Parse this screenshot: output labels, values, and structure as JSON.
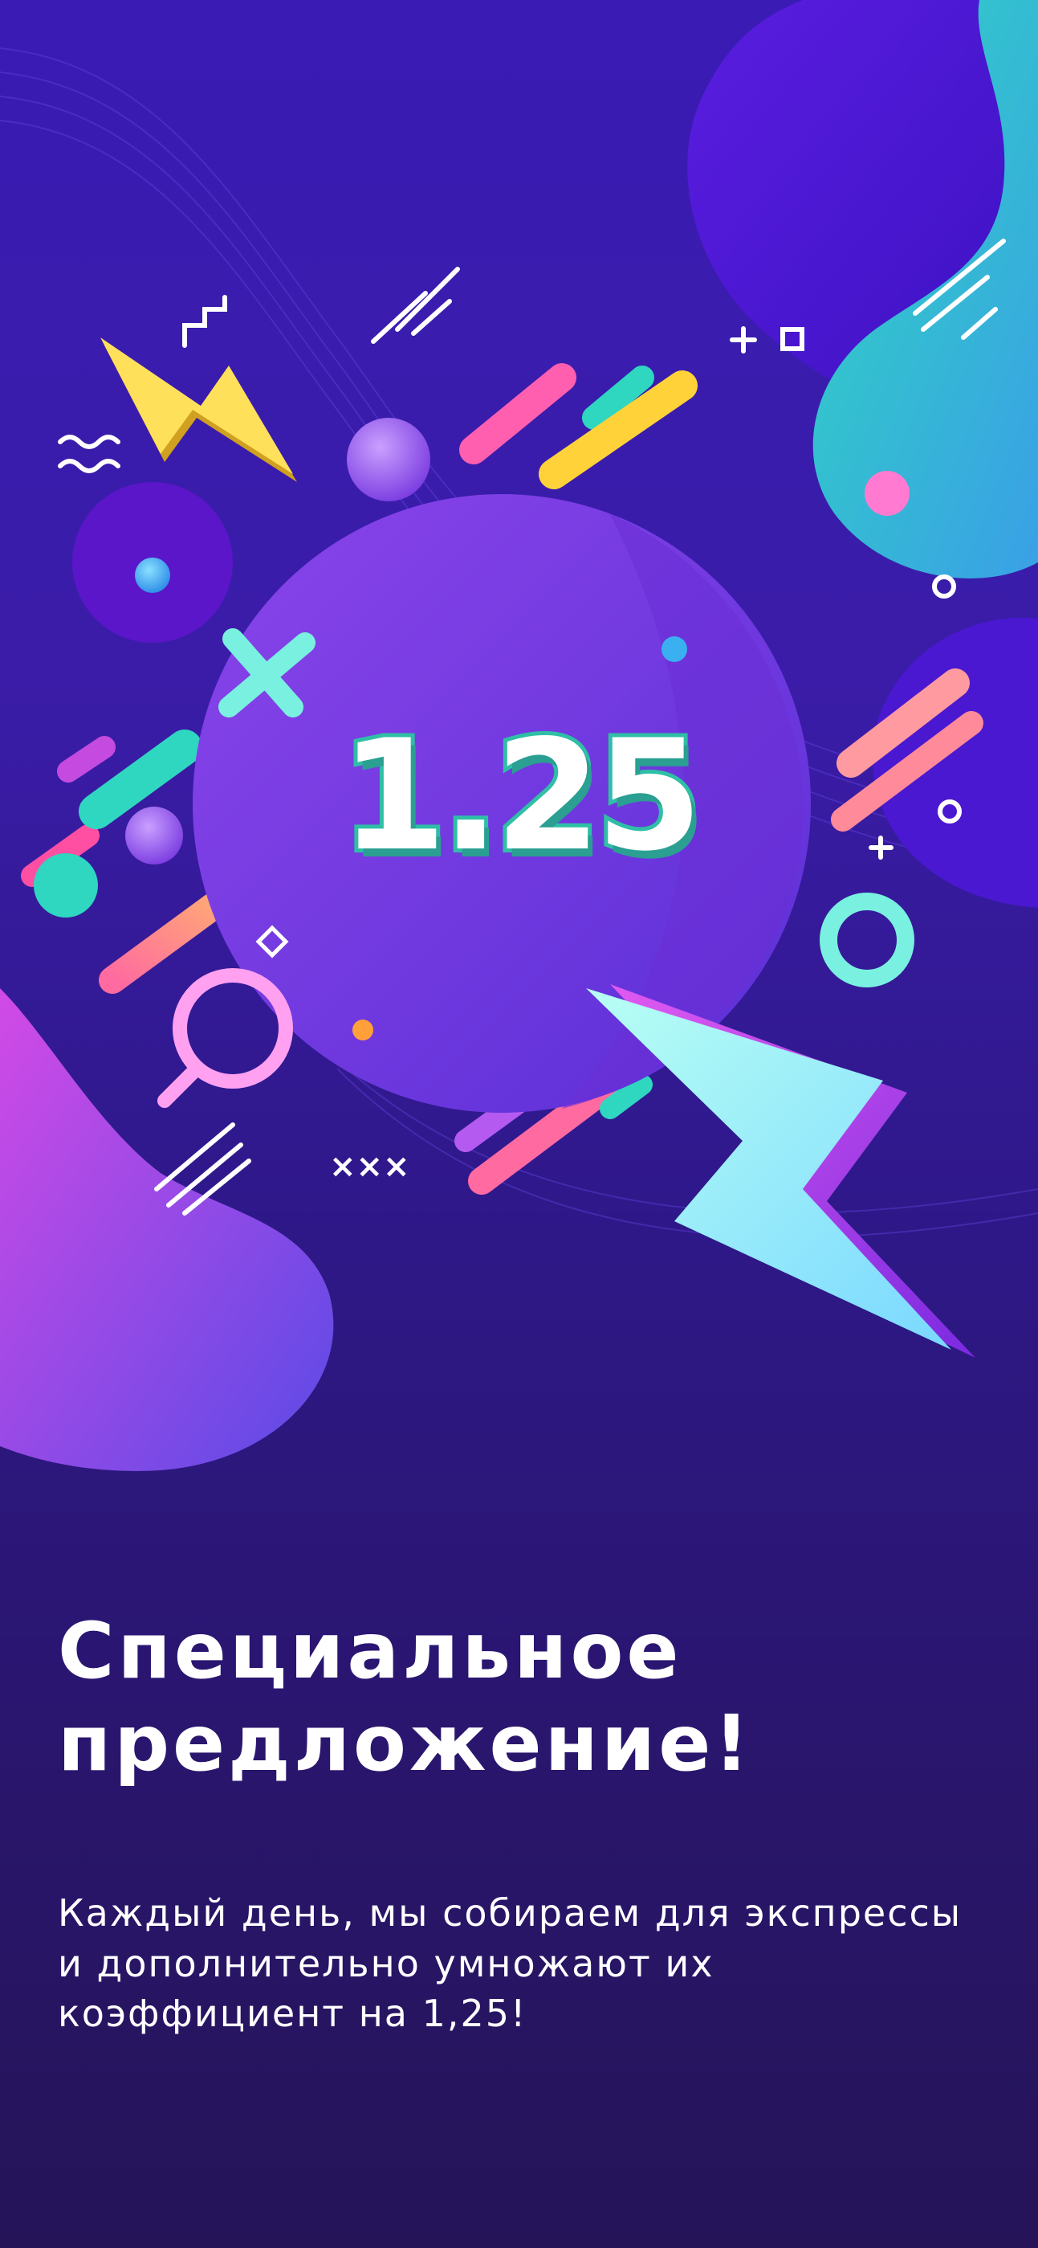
{
  "promo": {
    "multiplier": "1.25",
    "headline": "Специальное предложение!",
    "description": "Каждый день, мы собираем для экспрессы и дополнительно умножают их коэффициент на 1,25!"
  },
  "decor": {
    "cross_marks": "×××",
    "icons": [
      "lightning-bolt-icon",
      "zigzag-icon",
      "wave-icon",
      "plus-icon",
      "square-icon",
      "cross-icon",
      "ring-icon",
      "magnifier-icon"
    ]
  },
  "colors": {
    "background_top": "#3a1bb4",
    "background_bottom": "#251458",
    "circle": "#7a3ae0",
    "teal": "#2fd6c0",
    "pink": "#ff4fa3",
    "yellow": "#ffd23a"
  }
}
